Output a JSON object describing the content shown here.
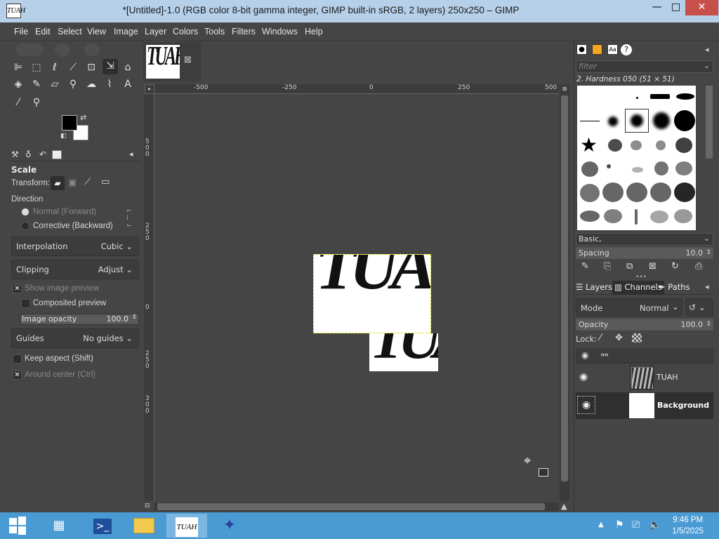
{
  "window": {
    "title": "*[Untitled]-1.0 (RGB color 8-bit gamma integer, GIMP built-in sRGB, 2 layers) 250x250 – GIMP",
    "app_icon_text": "TUAH",
    "minimize": "—",
    "maximize": "□",
    "close": "✕"
  },
  "menubar": [
    "File",
    "Edit",
    "Select",
    "View",
    "Image",
    "Layer",
    "Colors",
    "Tools",
    "Filters",
    "Windows",
    "Help"
  ],
  "tool_options": {
    "title": "Scale",
    "transform_label": "Transform:",
    "direction_label": "Direction",
    "direction_normal": "Normal (Forward)",
    "direction_corrective": "Corrective (Backward)",
    "interpolation_label": "Interpolation",
    "interpolation_value": "Cubic",
    "clipping_label": "Clipping",
    "clipping_value": "Adjust",
    "show_preview": "Show image preview",
    "composited_preview": "Composited preview",
    "image_opacity_label": "Image opacity",
    "image_opacity_value": "100.0",
    "guides_label": "Guides",
    "guides_value": "No guides",
    "keep_aspect": "Keep aspect (Shift)",
    "around_center": "Around center (Ctrl)"
  },
  "canvas": {
    "image_text": "TUAH",
    "hruler_labels": [
      "-500",
      "-250",
      "0",
      "250",
      "500"
    ],
    "vruler_labels": [
      "500",
      "250",
      "0",
      "250",
      "300"
    ]
  },
  "brushes": {
    "filter_placeholder": "filter",
    "selected_brush": "2. Hardness 050 (51 × 51)",
    "tag": "Basic,",
    "spacing_label": "Spacing",
    "spacing_value": "10.0"
  },
  "layers": {
    "tabs": [
      "Layers",
      "Channels",
      "Paths"
    ],
    "mode_label": "Mode",
    "mode_value": "Normal",
    "opacity_label": "Opacity",
    "opacity_value": "100.0",
    "lock_label": "Lock:",
    "items": [
      {
        "name": "TUAH",
        "visible": true,
        "bold": false
      },
      {
        "name": "Background",
        "visible": true,
        "bold": true
      }
    ]
  },
  "taskbar": {
    "time": "9:46 PM",
    "date": "1/5/2025"
  },
  "colors": {
    "fg": "#000000",
    "bg": "#ffffff",
    "taskbar": "#4a9ad4"
  }
}
